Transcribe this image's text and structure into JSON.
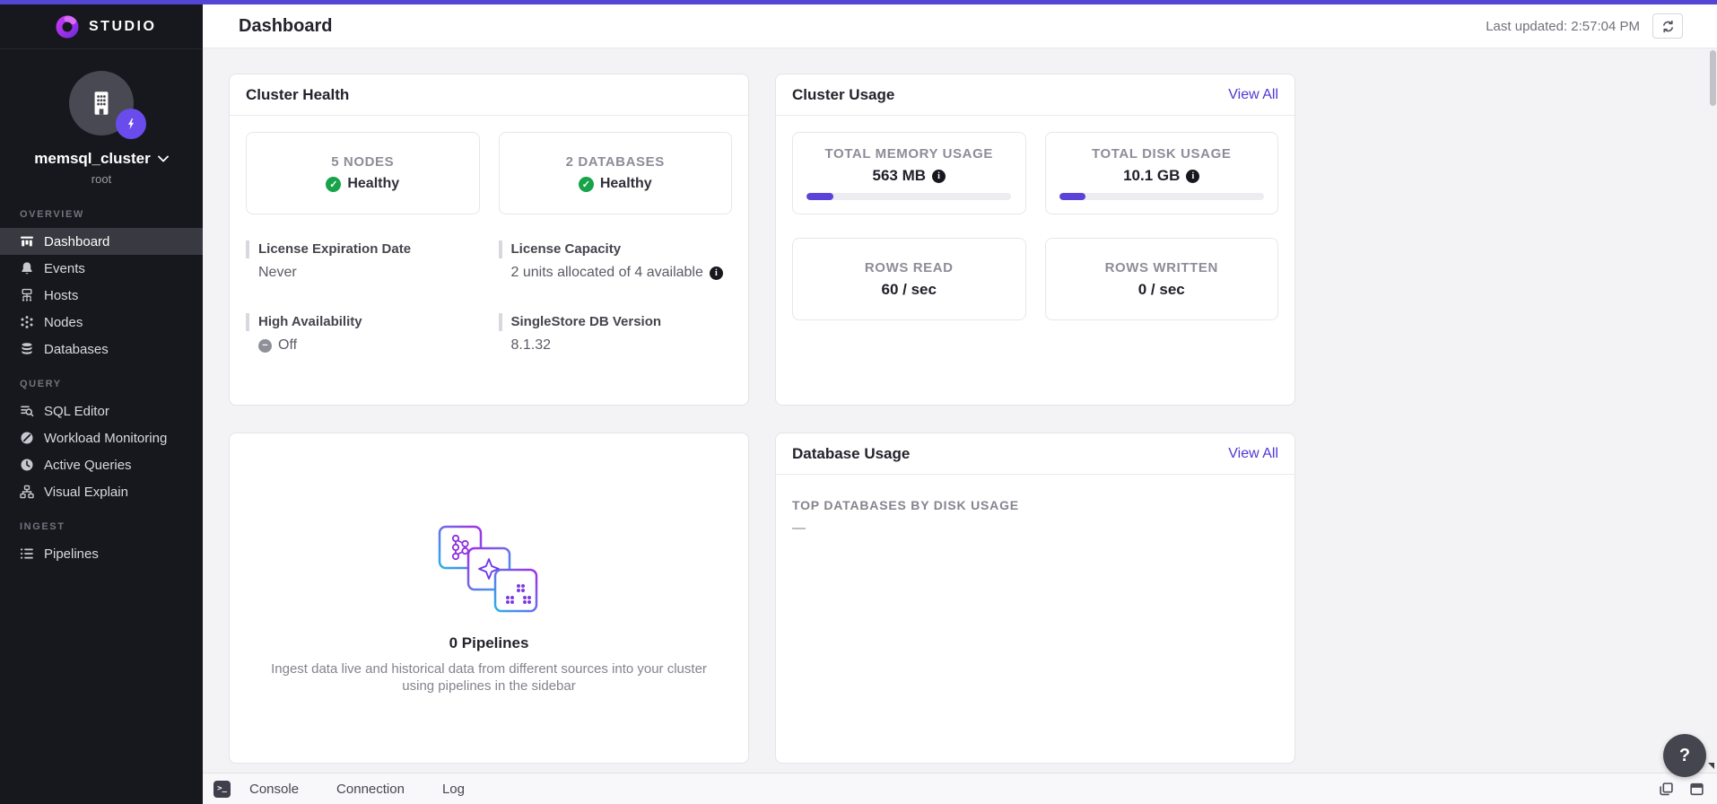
{
  "app": {
    "name": "STUDIO"
  },
  "header": {
    "title": "Dashboard",
    "last_updated": "Last updated: 2:57:04 PM"
  },
  "sidebar": {
    "cluster_name": "memsql_cluster",
    "cluster_user": "root",
    "sections": [
      {
        "label": "OVERVIEW",
        "items": [
          {
            "label": "Dashboard",
            "icon": "dashboard-icon",
            "active": true
          },
          {
            "label": "Events",
            "icon": "bell-icon"
          },
          {
            "label": "Hosts",
            "icon": "hosts-icon"
          },
          {
            "label": "Nodes",
            "icon": "nodes-icon"
          },
          {
            "label": "Databases",
            "icon": "databases-icon"
          }
        ]
      },
      {
        "label": "QUERY",
        "items": [
          {
            "label": "SQL Editor",
            "icon": "sql-editor-icon"
          },
          {
            "label": "Workload Monitoring",
            "icon": "gauge-icon"
          },
          {
            "label": "Active Queries",
            "icon": "clock-icon"
          },
          {
            "label": "Visual Explain",
            "icon": "tree-icon"
          }
        ]
      },
      {
        "label": "INGEST",
        "items": [
          {
            "label": "Pipelines",
            "icon": "pipelines-icon"
          }
        ]
      }
    ]
  },
  "cluster_health": {
    "title": "Cluster Health",
    "stats": [
      {
        "label": "5 NODES",
        "status": "Healthy"
      },
      {
        "label": "2 DATABASES",
        "status": "Healthy"
      }
    ],
    "details": [
      {
        "label": "License Expiration Date",
        "value": "Never"
      },
      {
        "label": "License Capacity",
        "value": "2 units allocated of 4 available"
      },
      {
        "label": "High Availability",
        "value": "Off"
      },
      {
        "label": "SingleStore DB Version",
        "value": "8.1.32"
      }
    ]
  },
  "cluster_usage": {
    "title": "Cluster Usage",
    "view_all": "View All",
    "meters": [
      {
        "label": "TOTAL MEMORY USAGE",
        "value": "563 MB",
        "percent": 13
      },
      {
        "label": "TOTAL DISK USAGE",
        "value": "10.1 GB",
        "percent": 13
      }
    ],
    "rates": [
      {
        "label": "ROWS READ",
        "value": "60 / sec"
      },
      {
        "label": "ROWS WRITTEN",
        "value": "0 / sec"
      }
    ]
  },
  "pipelines_card": {
    "title": "0 Pipelines",
    "description": "Ingest data live and historical data from different sources into your cluster using pipelines in the sidebar"
  },
  "database_usage": {
    "title": "Database Usage",
    "view_all": "View All",
    "subtitle": "TOP DATABASES BY DISK USAGE",
    "empty_value": "—"
  },
  "bottom_bar": {
    "tabs": [
      "Console",
      "Connection",
      "Log"
    ]
  },
  "help": {
    "label": "?"
  },
  "icons": {
    "check": "✓",
    "info": "i",
    "off": "−",
    "console": ">_"
  },
  "colors": {
    "accent": "#5346d5",
    "progress_fill": "#5b43d8",
    "healthy_green": "#17a349",
    "link": "#5236d3"
  }
}
